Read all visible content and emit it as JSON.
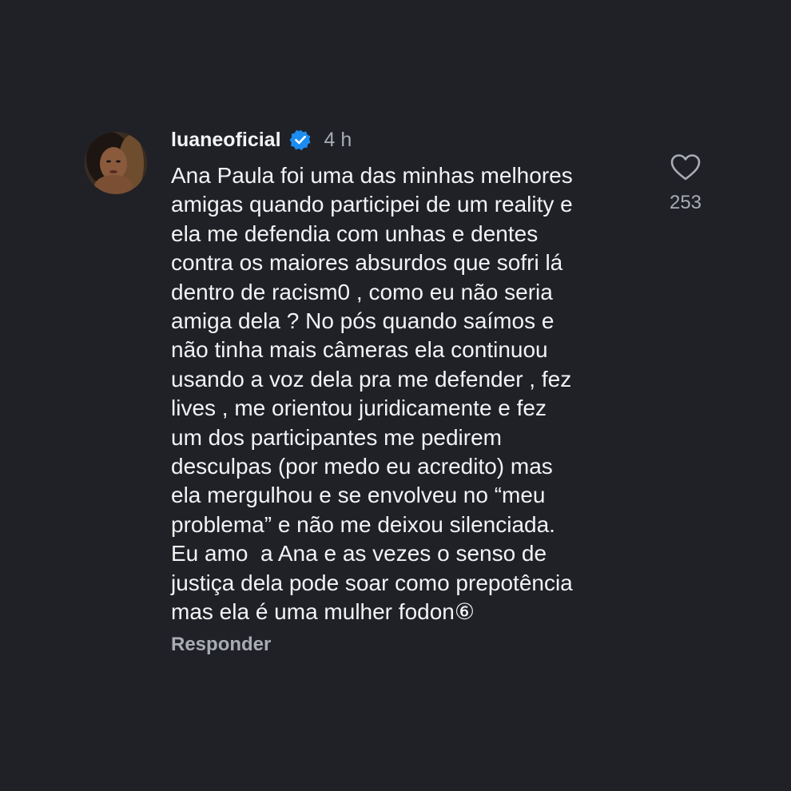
{
  "comment": {
    "username": "luaneoficial",
    "verified_icon": "verified-badge-icon",
    "verified_color": "#1d8cf0",
    "time": "4 h",
    "text_lines": [
      "Ana Paula foi uma das minhas melhores",
      "amigas quando participei de um reality e",
      "ela me defendia com unhas e dentes",
      "contra os maiores absurdos que sofri lá",
      "dentro de racism0 , como eu não seria",
      "amiga dela ? No pós quando saímos e",
      "não tinha mais câmeras ela continuou",
      "usando a voz dela pra me defender , fez",
      "lives , me orientou juridicamente e fez",
      "um dos participantes me pedirem",
      "desculpas (por medo eu acredito) mas",
      "ela mergulhou e se envolveu no “meu",
      "problema” e não me deixou silenciada.",
      "Eu amo  a Ana e as vezes o senso de",
      "justiça dela pode soar como prepotência",
      "mas ela é uma mulher fodon⑥"
    ],
    "reply_label": "Responder",
    "like_icon": "heart-icon",
    "like_count": "253"
  }
}
